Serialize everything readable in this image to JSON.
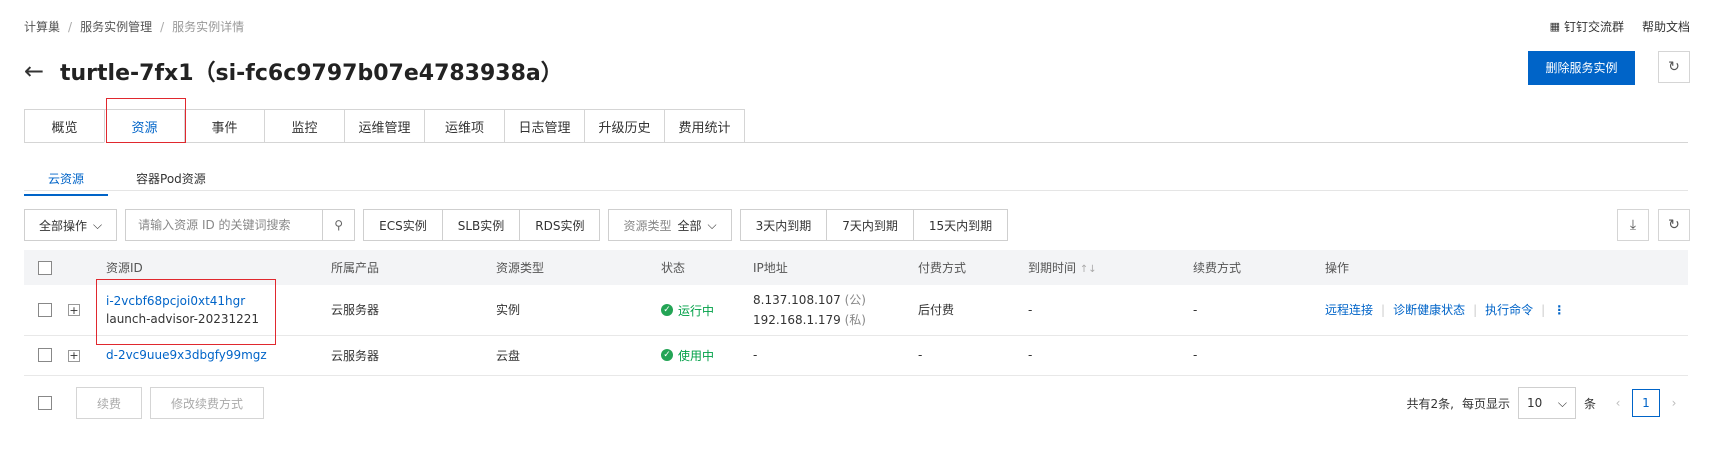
{
  "breadcrumb": [
    "计算巢",
    "服务实例管理",
    "服务实例详情"
  ],
  "top_links": {
    "dingtalk": "钉钉交流群",
    "help": "帮助文档"
  },
  "title": "turtle-7fx1（si-fc6c9797b07e4783938a）",
  "delete_button": "删除服务实例",
  "tabs": [
    "概览",
    "资源",
    "事件",
    "监控",
    "运维管理",
    "运维项",
    "日志管理",
    "升级历史",
    "费用统计"
  ],
  "active_tab": "资源",
  "subtabs": [
    "云资源",
    "容器Pod资源"
  ],
  "toolbar": {
    "bulk_action": "全部操作",
    "search_placeholder": "请输入资源 ID 的关键词搜索",
    "filter_buttons": [
      "ECS实例",
      "SLB实例",
      "RDS实例"
    ],
    "type_label": "资源类型",
    "type_value": "全部",
    "expiry_buttons": [
      "3天内到期",
      "7天内到期",
      "15天内到期"
    ]
  },
  "table": {
    "headers": [
      "资源ID",
      "所属产品",
      "资源类型",
      "状态",
      "IP地址",
      "付费方式",
      "到期时间",
      "续费方式",
      "操作"
    ],
    "sort_icon": "↑↓",
    "rows": [
      {
        "id": "i-2vcbf68pcjoi0xt41hgr",
        "name": "launch-advisor-20231221",
        "product": "云服务器",
        "type": "实例",
        "status": "运行中",
        "ip_public": "8.137.108.107",
        "ip_public_tag": "(公)",
        "ip_private": "192.168.1.179",
        "ip_private_tag": "(私)",
        "billing": "后付费",
        "expiry": "-",
        "renew": "-",
        "ops": [
          "远程连接",
          "诊断健康状态",
          "执行命令"
        ]
      },
      {
        "id": "d-2vc9uue9x3dbgfy99mgz",
        "product": "云服务器",
        "type": "云盘",
        "status": "使用中",
        "ip": "-",
        "billing": "-",
        "expiry": "-",
        "renew": "-"
      }
    ]
  },
  "footer": {
    "renew_button": "续费",
    "modify_renew_button": "修改续费方式",
    "total_prefix": "共有2条,",
    "per_page_label": "每页显示",
    "page_size": "10",
    "per_page_suffix": "条",
    "current_page": "1"
  },
  "colors": {
    "primary": "#0064c8",
    "success": "#23a455",
    "highlight": "#e0282e"
  }
}
